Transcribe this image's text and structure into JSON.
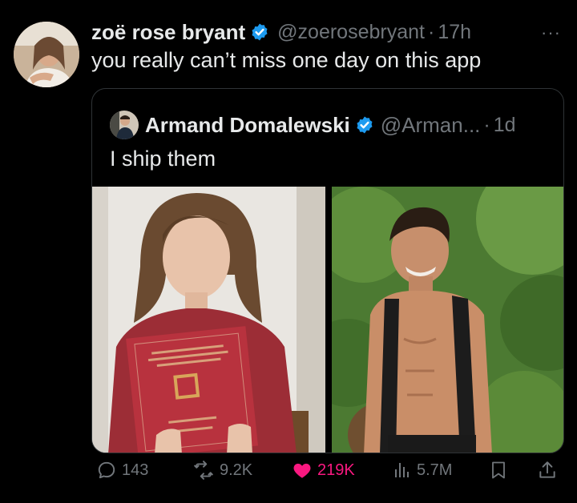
{
  "tweet": {
    "author_name": "zoë rose bryant",
    "handle": "@zoerosebryant",
    "separator": "·",
    "time": "17h",
    "more_label": "···",
    "text": "you really can’t miss one day on this app"
  },
  "quote": {
    "author_name": "Armand Domalewski",
    "handle": "@Arman...",
    "separator": "·",
    "time": "1d",
    "text": "I ship them"
  },
  "actions": {
    "replies": "143",
    "reposts": "9.2K",
    "likes": "219K",
    "views": "5.7M"
  },
  "colors": {
    "background": "#000000",
    "text": "#e7e9ea",
    "muted": "#71767b",
    "verified": "#1d9bf0",
    "like": "#f91880",
    "border": "#2f3336"
  },
  "icons": [
    "verified-badge-icon",
    "reply-icon",
    "repost-icon",
    "heart-icon",
    "views-icon",
    "bookmark-icon",
    "share-icon"
  ]
}
